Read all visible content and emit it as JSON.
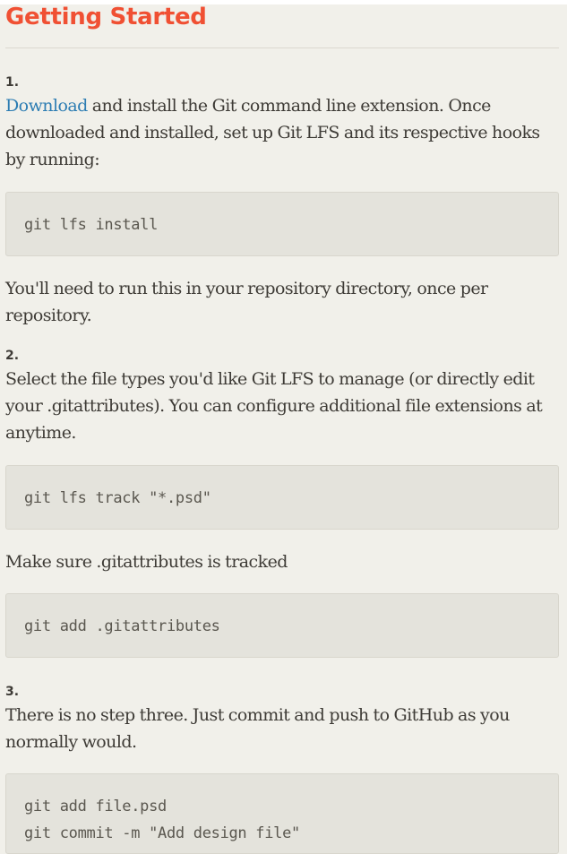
{
  "section_title": "Getting Started",
  "steps": [
    {
      "number": "1.",
      "link_text": "Download",
      "text": " and install the Git command line extension. Once downloaded and installed, set up Git LFS and its respective hooks by running:",
      "code": "git lfs install",
      "note": "You'll need to run this in your repository directory, once per repository."
    },
    {
      "number": "2.",
      "text": "Select the file types you'd like Git LFS to manage (or directly edit your .gitattributes). You can configure additional file extensions at anytime.",
      "code": "git lfs track \"*.psd\"",
      "note": "Make sure .gitattributes is tracked",
      "code2": "git add .gitattributes"
    },
    {
      "number": "3.",
      "text": "There is no step three. Just commit and push to GitHub as you normally would.",
      "code_lines": [
        "git add file.psd",
        "git commit -m \"Add design file\""
      ]
    }
  ]
}
